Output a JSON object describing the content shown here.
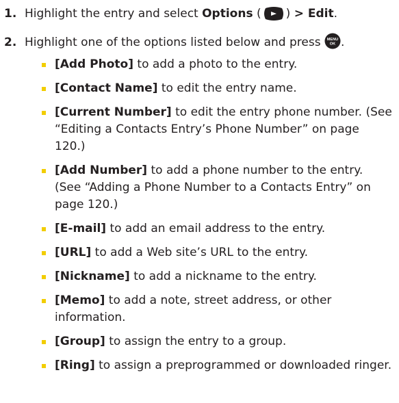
{
  "step1": {
    "number": "1.",
    "text": "Highlight the entry and select ",
    "options_label": "Options",
    "paren_open": " (",
    "paren_close": ") ",
    "arrow": ">",
    "edit_label": " Edit",
    "period": "."
  },
  "step2": {
    "number": "2.",
    "text": "Highlight one of the options listed below and press ",
    "menu_key_line1": "MENU",
    "menu_key_line2": "OK",
    "period": "."
  },
  "options": [
    {
      "label": "[Add Photo]",
      "text": " to add a photo to the entry."
    },
    {
      "label": "[Contact Name]",
      "text": " to edit the entry name."
    },
    {
      "label": "[Current Number]",
      "text": " to edit the entry phone number. (See “Editing a Contacts Entry’s Phone Number” on page 120.)"
    },
    {
      "label": "[Add Number]",
      "text": " to add a phone number to the entry. (See “Adding a Phone Number to a Contacts Entry” on page 120.)"
    },
    {
      "label": "[E-mail]",
      "text": " to add an email address to the entry."
    },
    {
      "label": "[URL]",
      "text": " to add a Web site’s URL to the entry."
    },
    {
      "label": "[Nickname]",
      "text": " to add a nickname to the entry."
    },
    {
      "label": "[Memo]",
      "text": " to add a note, street address, or other information."
    },
    {
      "label": "[Group]",
      "text": " to assign the entry to a group."
    },
    {
      "label": "[Ring]",
      "text": " to assign a preprogrammed or downloaded ringer."
    }
  ],
  "colors": {
    "text": "#231f20",
    "bullet": "#f2cd00",
    "key_fill": "#231f20"
  }
}
